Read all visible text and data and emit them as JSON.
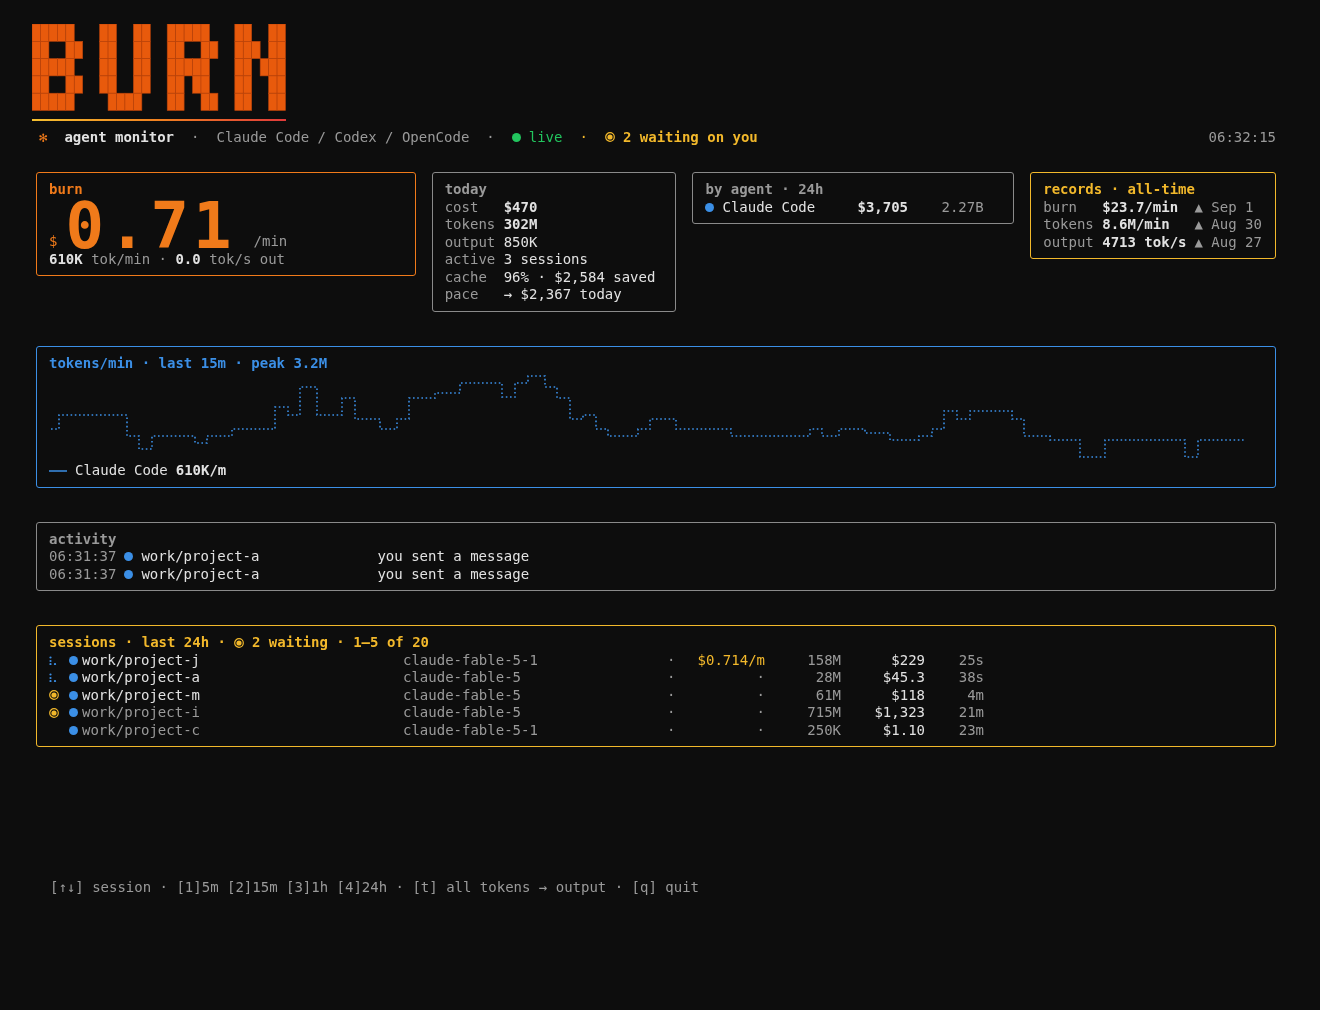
{
  "header": {
    "star": "✻",
    "app": "agent monitor",
    "sep1": "·",
    "agents": "Claude Code / Codex / OpenCode",
    "sep2": "·",
    "live": {
      "label": "live",
      "on": true
    },
    "sep3": "·",
    "waiting": "2 waiting on you",
    "time": "06:32:15"
  },
  "burn": {
    "title": "burn",
    "currency": "$",
    "value": "0.71",
    "unit": "/min",
    "detail": "**610K** tok/min · **0.0** tok/s out"
  },
  "today": {
    "title": "today",
    "rows": [
      {
        "label": "cost",
        "value": "$470",
        "bold": true
      },
      {
        "label": "tokens",
        "value": "302M",
        "bold": true
      },
      {
        "label": "output",
        "value": "850K",
        "bold": false
      },
      {
        "label": "active",
        "value": "3 sessions",
        "bold": false
      },
      {
        "label": "cache",
        "value": "96% · $2,584 saved",
        "bold": false
      },
      {
        "label": "pace",
        "value": "→ $2,367 today",
        "bold": false
      }
    ]
  },
  "by_agent": {
    "title": "by agent · 24h",
    "rows": [
      {
        "name": "Claude Code",
        "cost": "$3,705",
        "tokens": "2.27B"
      }
    ]
  },
  "records": {
    "title": "records · all-time",
    "rows": [
      {
        "label": "burn",
        "value": "$23.7/min",
        "when": "▲ Sep 1"
      },
      {
        "label": "tokens",
        "value": "8.6M/min",
        "when": "▲ Aug 30"
      },
      {
        "label": "output",
        "value": "4713 tok/s",
        "when": "▲ Aug 27"
      }
    ]
  },
  "chart": {
    "title": "tokens/min · last 15m · peak 3.2M",
    "legend": {
      "name": "Claude Code",
      "value": "610K/m"
    }
  },
  "activity": {
    "title": "activity",
    "rows": [
      {
        "time": "06:31:37",
        "project": "work/project-a",
        "event": "you sent a message"
      },
      {
        "time": "06:31:37",
        "project": "work/project-a",
        "event": "you sent a message"
      }
    ]
  },
  "sessions": {
    "title": "sessions · last 24h ·",
    "waiting": "2 waiting · 1–5 of 20",
    "rows": [
      {
        "kind": "working",
        "project": "work/project-j",
        "dimmed": false,
        "model": "claude-fable-5-1",
        "sep": "·",
        "rate": "$0.714/m",
        "rate_active": true,
        "tokens": "158M",
        "cost": "$229",
        "age": "25s"
      },
      {
        "kind": "working",
        "project": "work/project-a",
        "dimmed": false,
        "model": "claude-fable-5",
        "sep": "·",
        "rate": "·",
        "rate_active": false,
        "tokens": "28M",
        "cost": "$45.3",
        "age": "38s"
      },
      {
        "kind": "waiting",
        "project": "work/project-m",
        "dimmed": false,
        "model": "claude-fable-5",
        "sep": "·",
        "rate": "·",
        "rate_active": false,
        "tokens": "61M",
        "cost": "$118",
        "age": "4m"
      },
      {
        "kind": "waiting",
        "project": "work/project-i",
        "dimmed": true,
        "model": "claude-fable-5",
        "sep": "·",
        "rate": "·",
        "rate_active": false,
        "tokens": "715M",
        "cost": "$1,323",
        "age": "21m"
      },
      {
        "kind": "idle",
        "project": "work/project-c",
        "dimmed": true,
        "model": "claude-fable-5-1",
        "sep": "·",
        "rate": "·",
        "rate_active": false,
        "tokens": "250K",
        "cost": "$1.10",
        "age": "23m"
      }
    ]
  },
  "footer": "[↑↓] session · [1]5m [2]15m [3]1h [4]24h · [t] all tokens → output · [q] quit"
}
